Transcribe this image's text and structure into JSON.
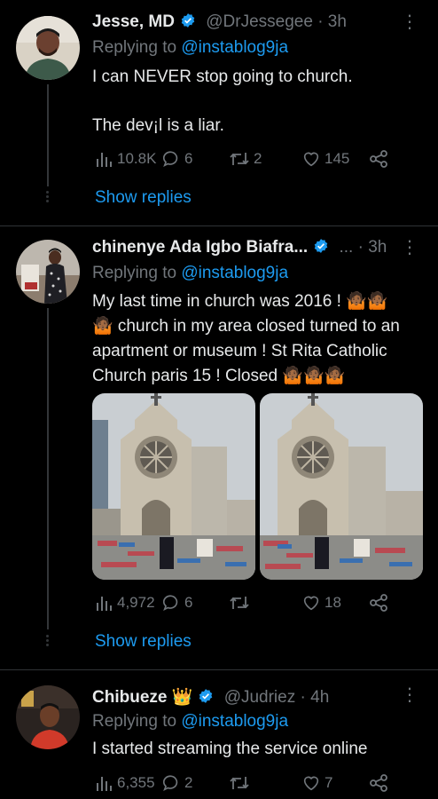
{
  "tweets": [
    {
      "name": "Jesse, MD",
      "handle": "@DrJessegee",
      "time": "· 3h",
      "replying_prefix": "Replying to",
      "replying_to": "@instablog9ja",
      "text_line1": "I can NEVER stop going to church.",
      "text_line2": "The dev¡l is a liar.",
      "views": "10.8K",
      "replies": "6",
      "retweets": "2",
      "likes": "145",
      "show_replies": "Show replies"
    },
    {
      "name": "chinenye Ada Igbo Biafra...",
      "handle": "...",
      "time": "· 3h",
      "replying_prefix": "Replying to",
      "replying_to": "@instablog9ja",
      "text_l1": "My last time in church was 2016 ! 🤷🏾🤷🏾",
      "text_l2": "🤷🏾 church in my area closed turned to an",
      "text_l3": "apartment or museum !  St Rita Catholic",
      "text_l4": "Church paris 15 ! Closed 🤷🏾🤷🏾🤷🏾",
      "views": "4,972",
      "replies": "6",
      "retweets": "",
      "likes": "18",
      "show_replies": "Show replies"
    },
    {
      "name": "Chibueze",
      "name_emoji": "👑",
      "handle": "@Judriez",
      "time": "· 4h",
      "replying_prefix": "Replying to",
      "replying_to": "@instablog9ja",
      "text": "I started streaming the service online",
      "views": "6,355",
      "replies": "2",
      "retweets": "",
      "likes": "7"
    }
  ],
  "colors": {
    "background": "#000000",
    "accent": "#1d9bf0",
    "muted": "#71767b",
    "text": "#e7e9ea"
  }
}
